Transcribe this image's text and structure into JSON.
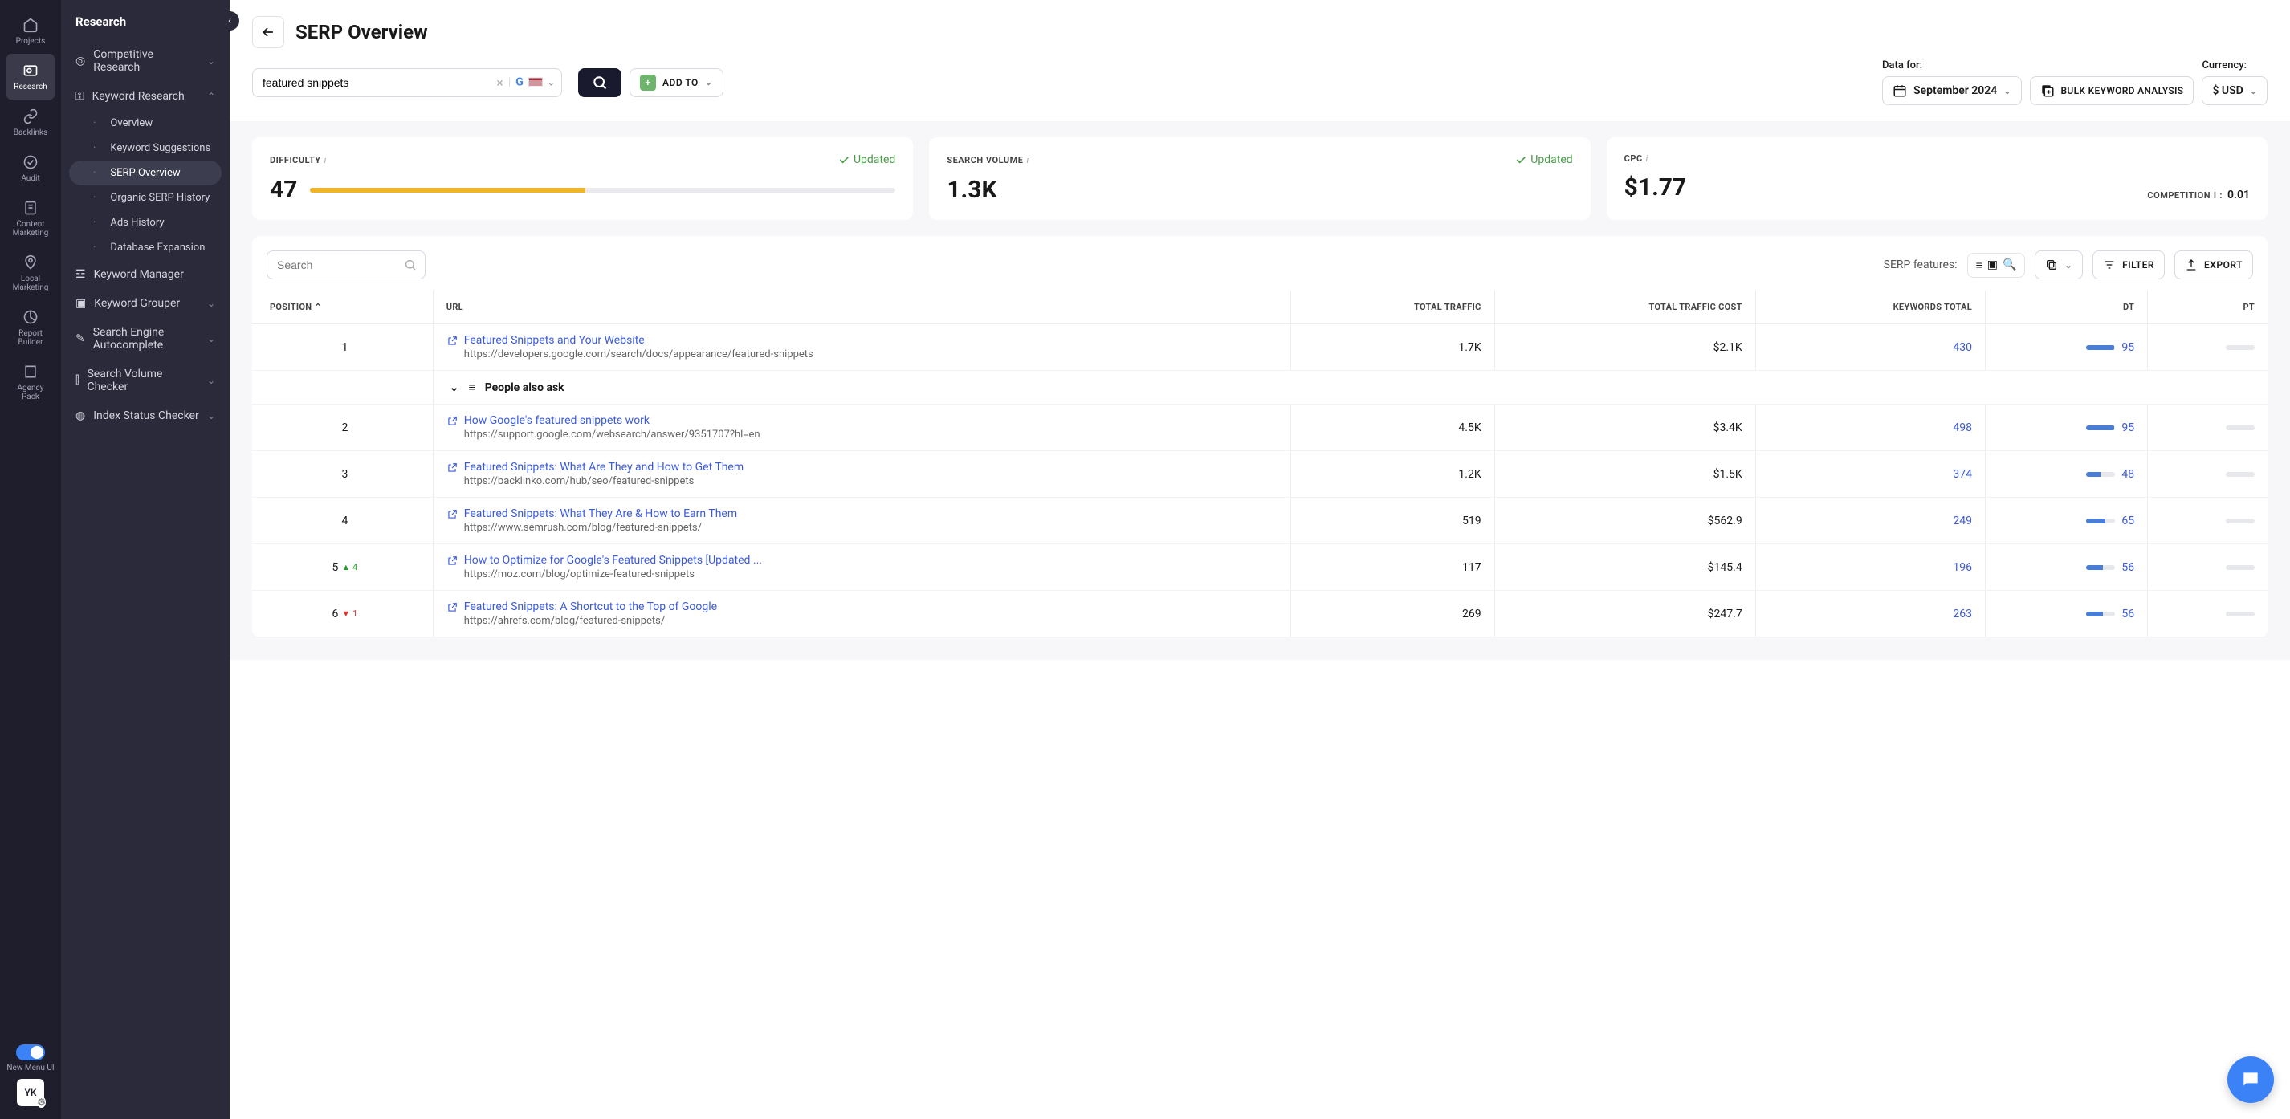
{
  "rail": {
    "items": [
      {
        "label": "Projects"
      },
      {
        "label": "Research"
      },
      {
        "label": "Backlinks"
      },
      {
        "label": "Audit"
      },
      {
        "label": "Content Marketing"
      },
      {
        "label": "Local Marketing"
      },
      {
        "label": "Report Builder"
      },
      {
        "label": "Agency Pack"
      }
    ],
    "toggle_label": "New Menu UI",
    "avatar": "YK"
  },
  "sidebar": {
    "title": "Research",
    "groups": {
      "competitive": "Competitive Research",
      "keyword": "Keyword Research",
      "km": "Keyword Manager",
      "kg": "Keyword Grouper",
      "sea": "Search Engine Autocomplete",
      "svc": "Search Volume Checker",
      "isc": "Index Status Checker"
    },
    "kw_subs": [
      {
        "label": "Overview"
      },
      {
        "label": "Keyword Suggestions"
      },
      {
        "label": "SERP Overview"
      },
      {
        "label": "Organic SERP History"
      },
      {
        "label": "Ads History"
      },
      {
        "label": "Database Expansion"
      }
    ]
  },
  "header": {
    "title": "SERP Overview",
    "keyword": "featured snippets",
    "addto": "ADD TO",
    "data_for": "Data for:",
    "date": "September 2024",
    "bulk": "BULK KEYWORD ANALYSIS",
    "currency_label": "Currency:",
    "currency": "$ USD"
  },
  "stats": {
    "difficulty": {
      "label": "DIFFICULTY",
      "value": "47",
      "status": "Updated",
      "pct": 47
    },
    "volume": {
      "label": "SEARCH VOLUME",
      "value": "1.3K",
      "status": "Updated"
    },
    "cpc": {
      "label": "CPC",
      "value": "$1.77"
    },
    "competition": {
      "label": "COMPETITION",
      "value": "0.01"
    }
  },
  "table_tools": {
    "search_placeholder": "Search",
    "serp_features": "SERP features:",
    "filter": "FILTER",
    "export": "EXPORT"
  },
  "columns": {
    "position": "POSITION",
    "url": "URL",
    "total_traffic": "TOTAL TRAFFIC",
    "total_traffic_cost": "TOTAL TRAFFIC COST",
    "keywords_total": "KEYWORDS TOTAL",
    "dt": "DT",
    "pt": "PT"
  },
  "paa_label": "People also ask",
  "rows": [
    {
      "pos": "1",
      "move": "",
      "title": "Featured Snippets and Your Website",
      "url": "https://developers.google.com/search/docs/appearance/featured-snippets",
      "traffic": "1.7K",
      "cost": "$2.1K",
      "kw": "430",
      "dt": 95,
      "pt": 0
    },
    {
      "pos": "2",
      "move": "",
      "title": "How Google's featured snippets work",
      "url": "https://support.google.com/websearch/answer/9351707?hl=en",
      "traffic": "4.5K",
      "cost": "$3.4K",
      "kw": "498",
      "dt": 95,
      "pt": 0
    },
    {
      "pos": "3",
      "move": "",
      "title": "Featured Snippets: What Are They and How to Get Them",
      "url": "https://backlinko.com/hub/seo/featured-snippets",
      "traffic": "1.2K",
      "cost": "$1.5K",
      "kw": "374",
      "dt": 48,
      "pt": 0
    },
    {
      "pos": "4",
      "move": "",
      "title": "Featured Snippets: What They Are & How to Earn Them",
      "url": "https://www.semrush.com/blog/featured-snippets/",
      "traffic": "519",
      "cost": "$562.9",
      "kw": "249",
      "dt": 65,
      "pt": 0
    },
    {
      "pos": "5",
      "move": "up",
      "move_val": "4",
      "title": "How to Optimize for Google's Featured Snippets [Updated ...",
      "url": "https://moz.com/blog/optimize-featured-snippets",
      "traffic": "117",
      "cost": "$145.4",
      "kw": "196",
      "dt": 56,
      "pt": 0
    },
    {
      "pos": "6",
      "move": "down",
      "move_val": "1",
      "title": "Featured Snippets: A Shortcut to the Top of Google",
      "url": "https://ahrefs.com/blog/featured-snippets/",
      "traffic": "269",
      "cost": "$247.7",
      "kw": "263",
      "dt": 56,
      "pt": 0
    }
  ]
}
